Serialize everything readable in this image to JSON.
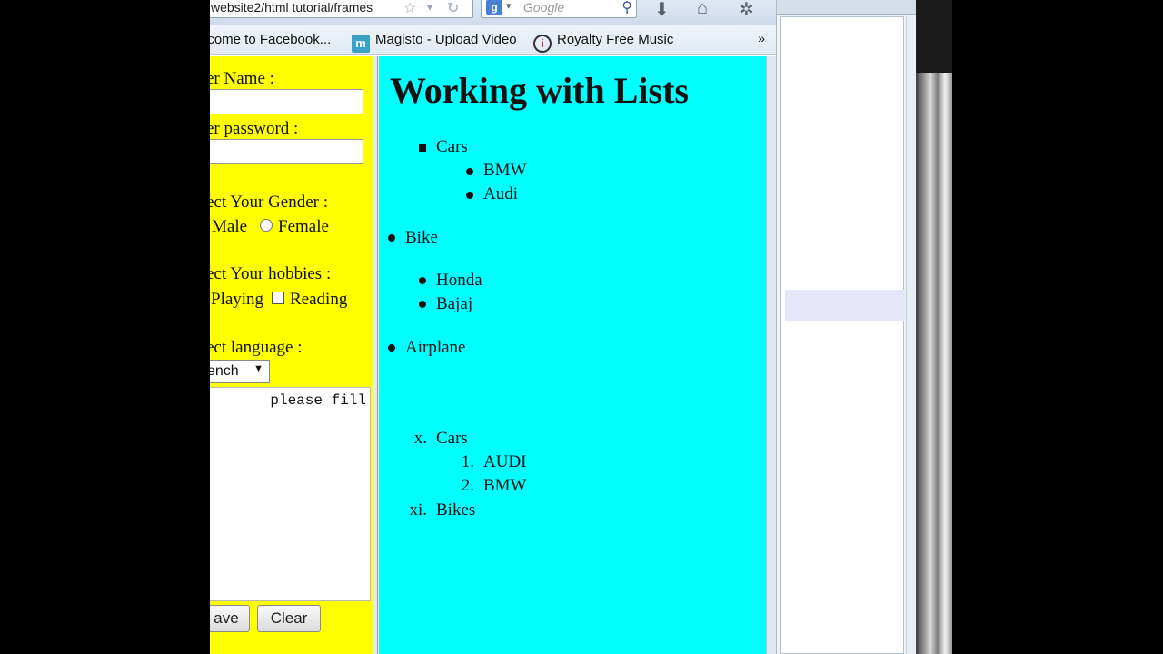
{
  "browser": {
    "url": "website2/html tutorial/frames",
    "search_placeholder": "Google",
    "bookmarks": [
      {
        "label": "lcome to Facebook..."
      },
      {
        "label": "Magisto - Upload Video"
      },
      {
        "label": "Royalty Free Music"
      }
    ],
    "bookmarks_more": "»"
  },
  "left_frame": {
    "username_label": "er Name :",
    "password_label": "er password :",
    "gender_label": "ect Your Gender :",
    "gender_options": [
      "Male",
      "Female"
    ],
    "hobbies_label": "ect Your hobbies :",
    "hobby_options": [
      "Playing",
      "Reading"
    ],
    "language_label": "ect language :",
    "language_selected": "ench",
    "textarea_text": "please fill",
    "save_button": "ave",
    "clear_button": "Clear"
  },
  "right_frame": {
    "title": "Working with Lists",
    "list1": {
      "item": "Cars",
      "subitems": [
        "BMW",
        "Audi"
      ]
    },
    "item_bike": "Bike",
    "bike_subitems": [
      "Honda",
      "Bajaj"
    ],
    "item_airplane": "Airplane",
    "ordered": {
      "items": [
        {
          "marker": "x.",
          "label": "Cars"
        },
        {
          "marker": "xi.",
          "label": "Bikes"
        }
      ],
      "subitems": [
        {
          "marker": "1.",
          "label": "AUDI"
        },
        {
          "marker": "2.",
          "label": "BMW"
        }
      ]
    }
  }
}
